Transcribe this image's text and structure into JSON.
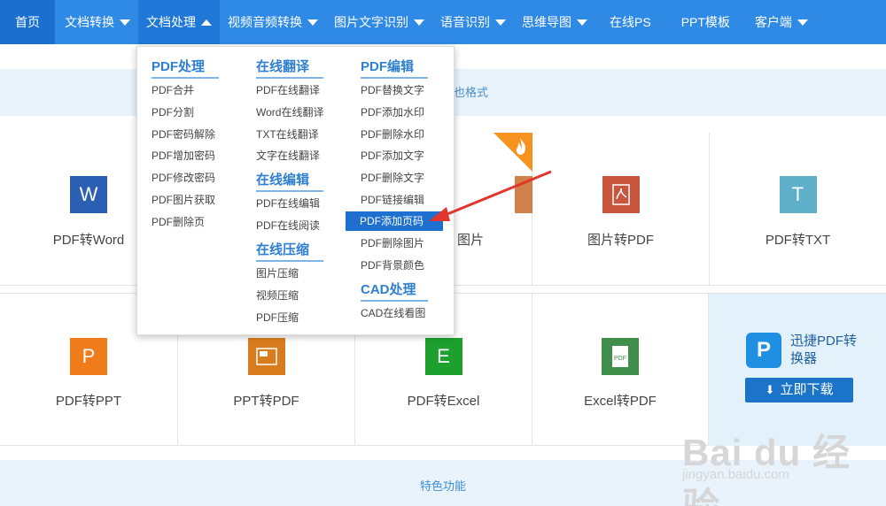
{
  "nav": {
    "items": [
      {
        "label": "首页",
        "caret": ""
      },
      {
        "label": "文档转换",
        "caret": "down"
      },
      {
        "label": "文档处理",
        "caret": "up"
      },
      {
        "label": "视频音频转换",
        "caret": "down"
      },
      {
        "label": "图片文字识别",
        "caret": "down"
      },
      {
        "label": "语音识别",
        "caret": "down"
      },
      {
        "label": "思维导图",
        "caret": "down"
      },
      {
        "label": "在线PS",
        "caret": ""
      },
      {
        "label": "PPT模板",
        "caret": ""
      },
      {
        "label": "客户端",
        "caret": "down"
      }
    ]
  },
  "banner_top": {
    "text": "也格式"
  },
  "banner_bottom": {
    "text": "特色功能"
  },
  "dropdown": {
    "pdf_process": {
      "title": "PDF处理",
      "items": [
        "PDF合并",
        "PDF分割",
        "PDF密码解除",
        "PDF增加密码",
        "PDF修改密码",
        "PDF图片获取",
        "PDF删除页"
      ]
    },
    "translate": {
      "title": "在线翻译",
      "items": [
        "PDF在线翻译",
        "Word在线翻译",
        "TXT在线翻译",
        "文字在线翻译"
      ]
    },
    "edit": {
      "title": "在线编辑",
      "items": [
        "PDF在线编辑",
        "PDF在线阅读"
      ]
    },
    "compress": {
      "title": "在线压缩",
      "items": [
        "图片压缩",
        "视频压缩",
        "PDF压缩"
      ]
    },
    "pdf_edit": {
      "title": "PDF编辑",
      "items": [
        "PDF替换文字",
        "PDF添加水印",
        "PDF删除水印",
        "PDF添加文字",
        "PDF删除文字",
        "PDF链接编辑",
        "PDF添加页码",
        "PDF删除图片",
        "PDF背景颜色"
      ],
      "active_index": 6
    },
    "cad": {
      "title": "CAD处理",
      "items": [
        "CAD在线看图"
      ]
    }
  },
  "tools": {
    "row1": [
      {
        "label": "PDF转Word",
        "icon": "W",
        "color": "#2b5fb4",
        "icon_name": "word-icon"
      },
      {
        "label": "",
        "icon": "",
        "color": "#ffffff",
        "icon_name": "hidden-icon"
      },
      {
        "label": "图片",
        "icon": "",
        "color": "#d2804a",
        "icon_name": "image-icon"
      },
      {
        "label": "图片转PDF",
        "icon": "⌁",
        "color": "#c8553d",
        "icon_name": "pdf-icon"
      },
      {
        "label": "PDF转TXT",
        "icon": "T",
        "color": "#5eb0c8",
        "icon_name": "txt-icon"
      }
    ],
    "row2": [
      {
        "label": "PDF转PPT",
        "icon": "P",
        "color": "#f07b1a",
        "icon_name": "ppt-icon"
      },
      {
        "label": "PPT转PDF",
        "icon": "▭",
        "color": "#d97c1d",
        "icon_name": "ppt-pdf-icon"
      },
      {
        "label": "PDF转Excel",
        "icon": "E",
        "color": "#1ea02f",
        "icon_name": "excel-icon"
      },
      {
        "label": "Excel转PDF",
        "icon": "PDF",
        "color": "#3f8f4a",
        "icon_name": "excel-pdf-icon"
      }
    ]
  },
  "promo": {
    "logo": "P",
    "title": "迅捷PDF转换器",
    "button": "立即下载",
    "button_icon": "⬇"
  },
  "watermark": {
    "brand": "Bai du 经验",
    "sub": "jingyan.baidu.com"
  }
}
